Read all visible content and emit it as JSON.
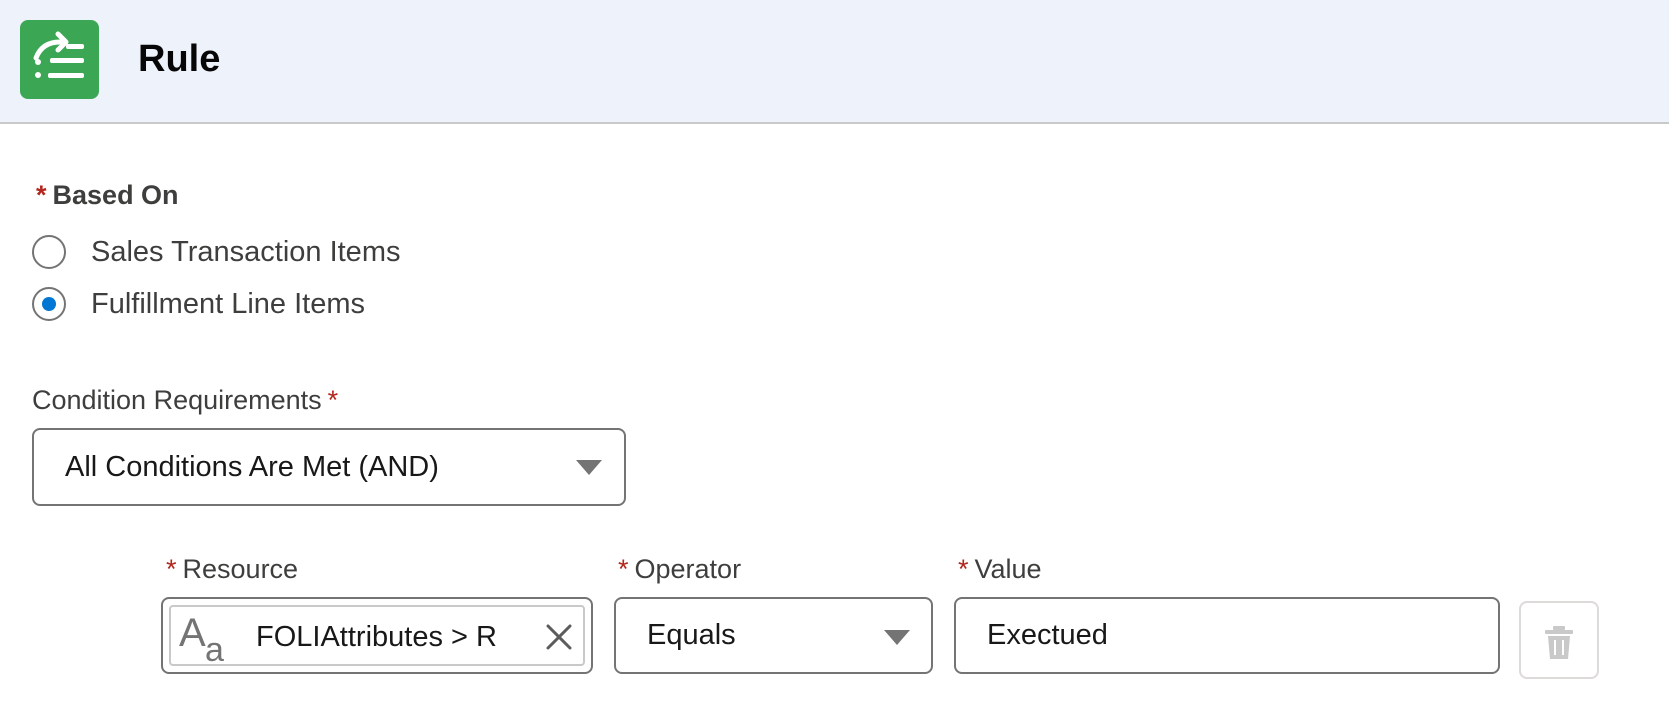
{
  "header": {
    "title": "Rule",
    "icon": "flow-decision-icon",
    "icon_bg": "#3ba755"
  },
  "based_on": {
    "label": "Based On",
    "required_mark": "*",
    "options": [
      {
        "label": "Sales Transaction Items",
        "checked": false
      },
      {
        "label": "Fulfillment Line Items",
        "checked": true
      }
    ]
  },
  "condition_requirements": {
    "label": "Condition Requirements",
    "required_mark": "*",
    "selected": "All Conditions Are Met (AND)"
  },
  "condition_row": {
    "resource": {
      "label": "Resource",
      "required_mark": "*",
      "value": "FOLIAttributes > R",
      "type_icon": "text-type-icon"
    },
    "operator": {
      "label": "Operator",
      "required_mark": "*",
      "selected": "Equals"
    },
    "value": {
      "label": "Value",
      "required_mark": "*",
      "value": "Exectued"
    },
    "delete_icon": "trash-icon"
  },
  "colors": {
    "accent": "#0176d3",
    "required": "#b3261e",
    "header_bg": "#eef2fb"
  }
}
